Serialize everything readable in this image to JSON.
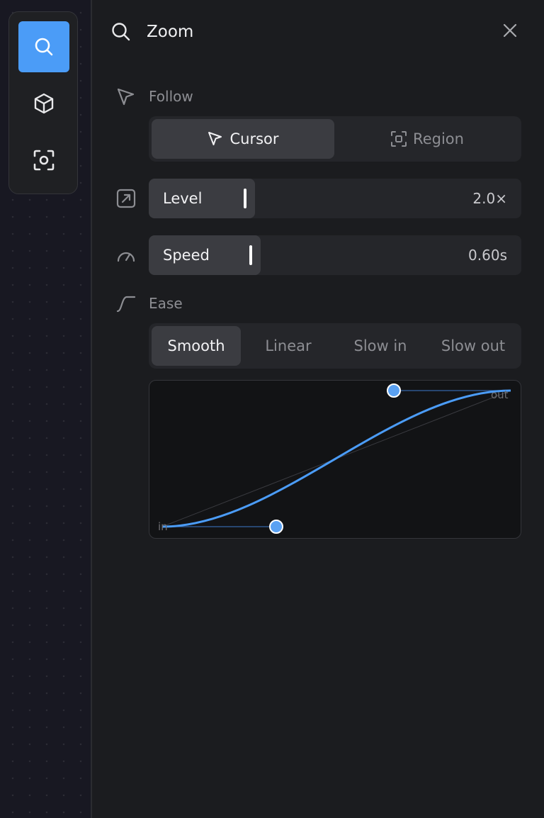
{
  "toolbar": {
    "tools": [
      {
        "icon": "search-icon",
        "active": true
      },
      {
        "icon": "cube-icon",
        "active": false
      },
      {
        "icon": "focus-icon",
        "active": false
      }
    ]
  },
  "panel": {
    "title": "Zoom",
    "follow": {
      "label": "Follow",
      "options": [
        "Cursor",
        "Region"
      ],
      "selected": "Cursor"
    },
    "level": {
      "label": "Level",
      "value": "2.0×",
      "fraction": 0.29
    },
    "speed": {
      "label": "Speed",
      "value": "0.60s",
      "fraction": 0.3
    },
    "ease": {
      "label": "Ease",
      "options": [
        "Smooth",
        "Linear",
        "Slow in",
        "Slow out"
      ],
      "selected": "Smooth",
      "curve": {
        "start_label": "in",
        "end_label": "out"
      }
    }
  },
  "colors": {
    "accent": "#4b9cf7",
    "panel_bg": "#1b1c1f",
    "control_bg": "#25262a",
    "control_active": "#3b3c41"
  }
}
